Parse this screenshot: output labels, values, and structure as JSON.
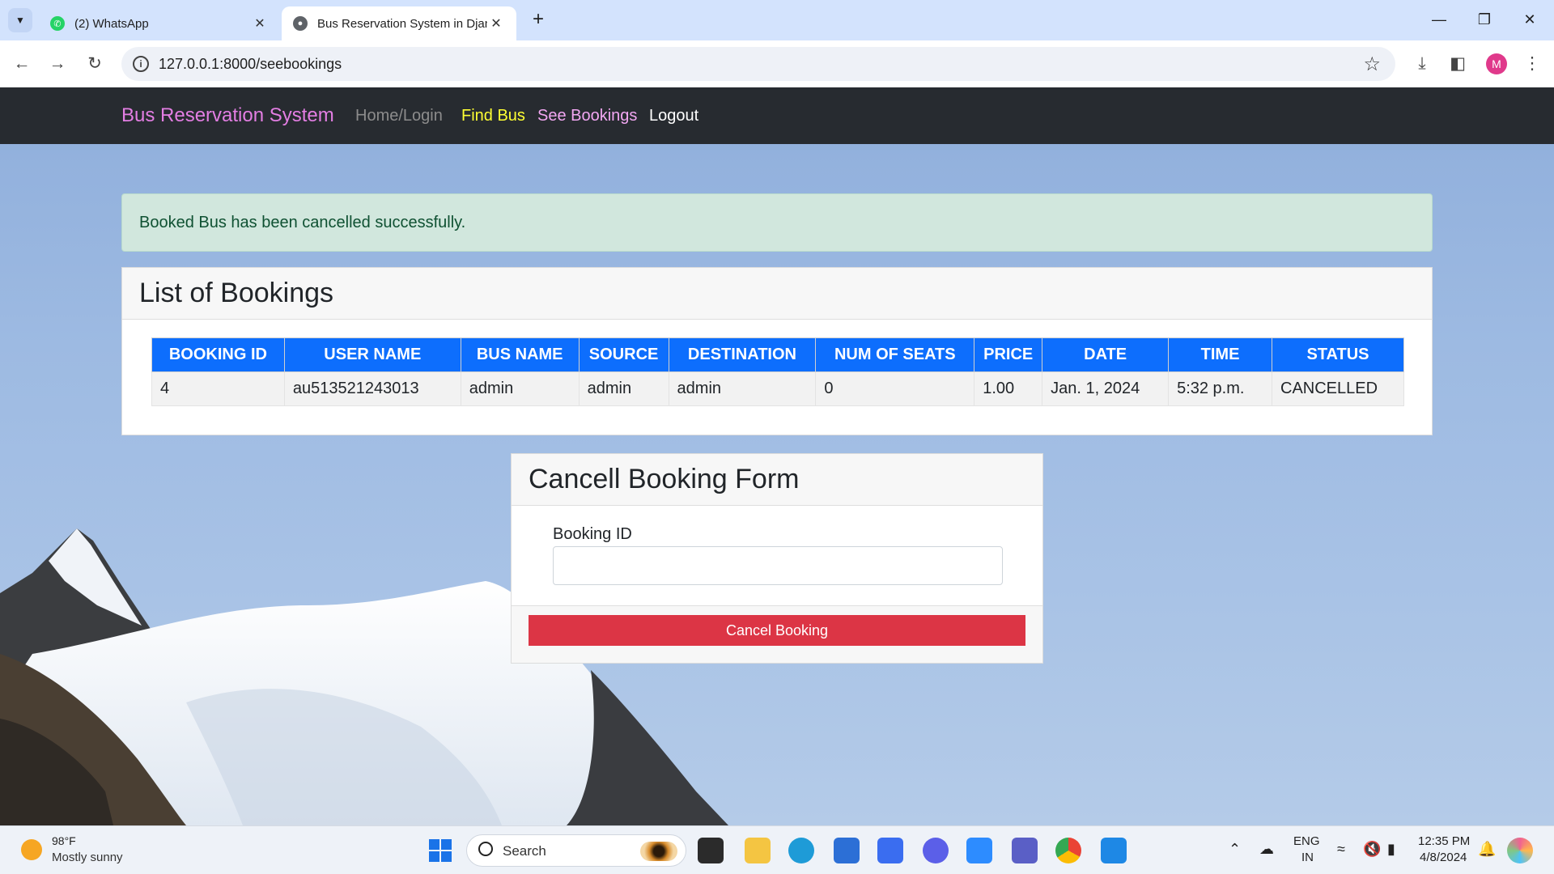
{
  "browser": {
    "tabs": [
      {
        "title": "(2) WhatsApp",
        "icon": "whatsapp-icon"
      },
      {
        "title": "Bus Reservation System in Djan",
        "icon": "globe-icon"
      }
    ],
    "url": "127.0.0.1:8000/seebookings",
    "profile_initial": "M"
  },
  "nav": {
    "brand": "Bus Reservation System",
    "links": [
      {
        "label": "Home/Login",
        "color": "#8c8c8c"
      },
      {
        "label": "Find Bus",
        "color": "#ffff33"
      },
      {
        "label": "See Bookings",
        "color": "#f2a7f2"
      },
      {
        "label": "Logout",
        "color": "#ffffff"
      }
    ]
  },
  "alert": {
    "message": "Booked Bus has been cancelled successfully."
  },
  "bookings": {
    "title": "List of Bookings",
    "columns": [
      "BOOKING ID",
      "USER NAME",
      "BUS NAME",
      "SOURCE",
      "DESTINATION",
      "NUM OF SEATS",
      "PRICE",
      "DATE",
      "TIME",
      "STATUS"
    ],
    "rows": [
      [
        "4",
        "au513521243013",
        "admin",
        "admin",
        "admin",
        "0",
        "1.00",
        "Jan. 1, 2024",
        "5:32 p.m.",
        "CANCELLED"
      ]
    ]
  },
  "cancel_form": {
    "title": "Cancell Booking Form",
    "label": "Booking ID",
    "value": "",
    "button": "Cancel Booking"
  },
  "taskbar": {
    "weather_temp": "98°F",
    "weather_desc": "Mostly sunny",
    "search_label": "Search",
    "lang_top": "ENG",
    "lang_bottom": "IN",
    "time": "12:35 PM",
    "date": "4/8/2024"
  },
  "colors": {
    "navbar": "#272b30",
    "brand": "#e37ee3",
    "table_header": "#0d6efd",
    "danger": "#dc3545",
    "alert_bg": "#d1e7dd"
  }
}
